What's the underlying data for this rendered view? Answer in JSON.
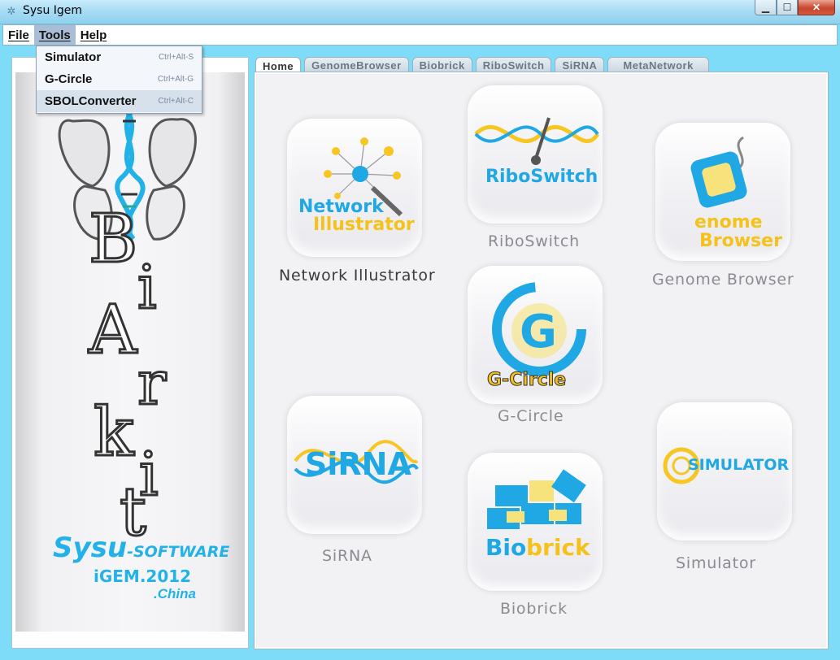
{
  "window": {
    "title": "Sysu Igem",
    "min": "▁",
    "max": "☐",
    "close": "✕"
  },
  "menubar": {
    "items": [
      "File",
      "Tools",
      "Help"
    ]
  },
  "tools_menu": {
    "items": [
      {
        "label": "Simulator",
        "accel": "Ctrl+Alt-S"
      },
      {
        "label": "G-Circle",
        "accel": "Ctrl+Alt-G"
      },
      {
        "label": "SBOLConverter",
        "accel": "Ctrl+Alt-C"
      }
    ]
  },
  "logo": {
    "letters": [
      "B",
      "i",
      "A",
      "r",
      "k",
      "i",
      "t"
    ],
    "sysu": "Sysu",
    "software": "-SOFTWARE",
    "igem": "iGEM.2012",
    "china": ".China"
  },
  "tabs": [
    "Home",
    "GenomeBrowser",
    "Biobrick",
    "RiboSwitch",
    "SiRNA",
    "MetaNetwork"
  ],
  "tiles": {
    "network": {
      "line1": "Network",
      "line2": "Illustrator",
      "caption": "Network Illustrator"
    },
    "riboswitch": {
      "label": "RiboSwitch",
      "caption": "RiboSwitch"
    },
    "genome": {
      "line1": "enome",
      "line2": "Browser",
      "caption": "Genome Browser"
    },
    "gcircle": {
      "label": "G-Circle",
      "caption": "G-Circle"
    },
    "sirna": {
      "label": "SiRNA",
      "caption": "SiRNA"
    },
    "biobrick": {
      "label1": "Bio",
      "label2": "brick",
      "caption": "Biobrick"
    },
    "simulator": {
      "label": "SIMULATOR",
      "caption": "Simulator"
    }
  },
  "colors": {
    "accent_blue": "#1fa8e4",
    "accent_yellow": "#f7c623",
    "window_bg": "#7fdcf8"
  }
}
